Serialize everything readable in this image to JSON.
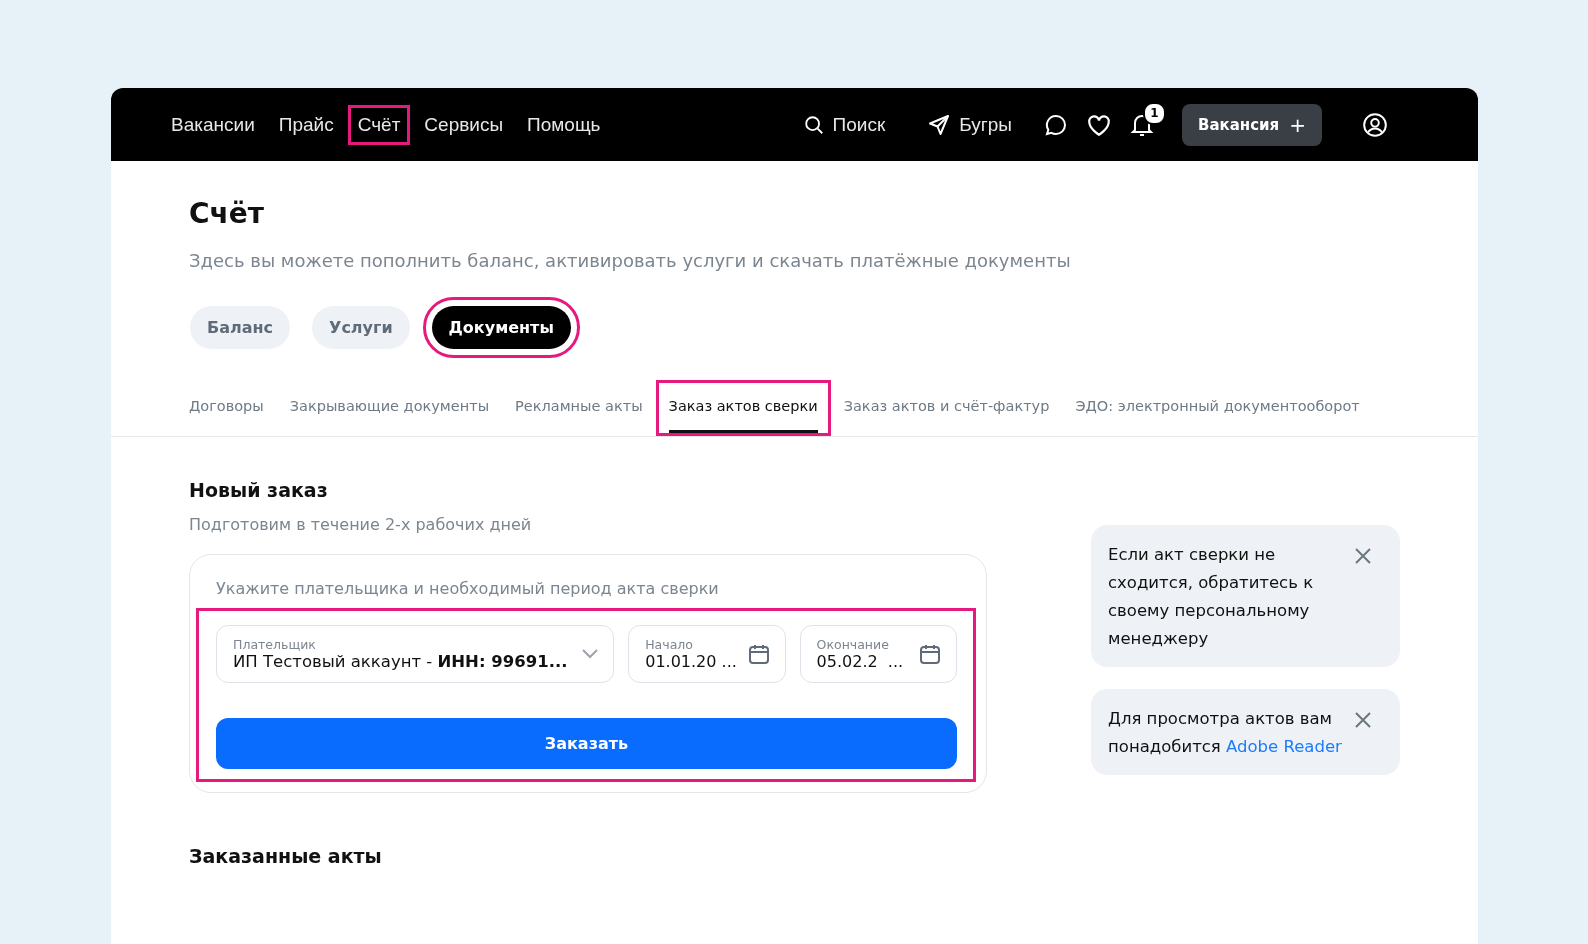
{
  "nav": {
    "items": [
      {
        "label": "Вакансии",
        "highlighted": false
      },
      {
        "label": "Прайс",
        "highlighted": false
      },
      {
        "label": "Счёт",
        "highlighted": true
      },
      {
        "label": "Сервисы",
        "highlighted": false
      },
      {
        "label": "Помощь",
        "highlighted": false
      }
    ],
    "search": "Поиск",
    "bugry": "Бугры",
    "notifications": "1",
    "vacancy_button": "Вакансия",
    "vacancy_plus": "+"
  },
  "page": {
    "title": "Счёт",
    "subtitle": "Здесь вы можете пополнить баланс, активировать услуги и скачать платёжные документы"
  },
  "pills": [
    {
      "label": "Баланс",
      "selected": false,
      "highlighted": false
    },
    {
      "label": "Услуги",
      "selected": false,
      "highlighted": false
    },
    {
      "label": "Документы",
      "selected": true,
      "highlighted": true
    }
  ],
  "tabs": [
    {
      "label": "Договоры",
      "selected": false,
      "highlighted": false
    },
    {
      "label": "Закрывающие документы",
      "selected": false,
      "highlighted": false
    },
    {
      "label": "Рекламные акты",
      "selected": false,
      "highlighted": false
    },
    {
      "label": "Заказ актов сверки",
      "selected": true,
      "highlighted": true
    },
    {
      "label": "Заказ актов и счёт-фактур",
      "selected": false,
      "highlighted": false
    },
    {
      "label": "ЭДО: электронный документооборот",
      "selected": false,
      "highlighted": false
    }
  ],
  "new_order": {
    "title": "Новый заказ",
    "subtitle": "Подготовим в течение 2-х рабочих дней",
    "form": {
      "hint": "Укажите плательщика и необходимый период акта сверки",
      "highlighted": true,
      "payer": {
        "label": "Плательщик",
        "value": "ИП Тестовый аккаунт - **ИНН: 99691...**"
      },
      "start": {
        "label": "Начало",
        "value": "01.01.20 ..."
      },
      "end": {
        "label": "Окончание",
        "value": "05.02.2  ..."
      },
      "button": "Заказать"
    }
  },
  "notices": [
    {
      "text": "Если акт сверки не сходится, обратитесь к своему персональному менеджеру"
    },
    {
      "text": "Для просмотра актов вам понадобится",
      "link": "Adobe Reader"
    }
  ],
  "ordered": {
    "title": "Заказанные акты"
  }
}
